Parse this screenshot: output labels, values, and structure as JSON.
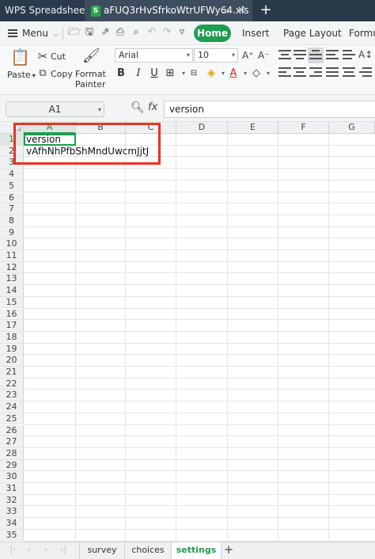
{
  "window": {
    "app_tab": "WPS Spreadsheets",
    "file_tab": "aFUQ3rHvSfrkoWtrUFWy64.xls",
    "file_icon_letter": "S",
    "add_tab_symbol": "+"
  },
  "menubar": {
    "menu_label": "Menu",
    "tabs": [
      "Home",
      "Insert",
      "Page Layout",
      "Formul"
    ]
  },
  "ribbon": {
    "paste": "Paste",
    "cut": "Cut",
    "copy": "Copy",
    "format_painter_line1": "Format",
    "format_painter_line2": "Painter",
    "font_name": "Arial",
    "font_size": "10"
  },
  "formula_bar": {
    "name_box": "A1",
    "fx": "fx",
    "content": "version"
  },
  "grid": {
    "columns": [
      "A",
      "B",
      "C",
      "D",
      "E",
      "F",
      "G"
    ],
    "row_count": 35,
    "selected_column": "A",
    "selected_row": 1,
    "cells": {
      "A1": "version",
      "A2": "vAfhNhPfbShMndUwcmJjtJ"
    }
  },
  "sheets": {
    "tabs": [
      "survey",
      "choices",
      "settings"
    ],
    "active": "settings",
    "add_symbol": "+"
  },
  "colors": {
    "accent_green": "#1e9d4f",
    "annotation_red": "#e8341f",
    "titlebar": "#2b3a4a"
  }
}
